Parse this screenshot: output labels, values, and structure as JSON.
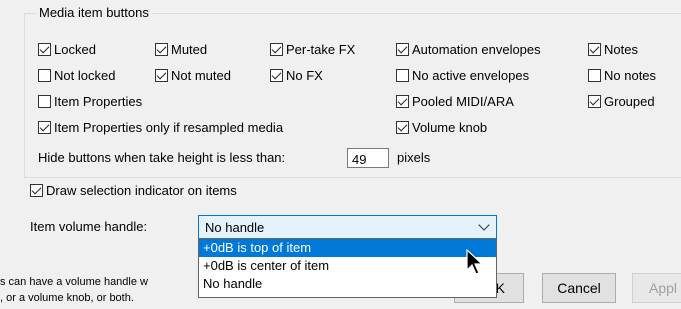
{
  "group": {
    "title": "Media item buttons",
    "checkboxes": [
      {
        "label": "Locked",
        "checked": true
      },
      {
        "label": "Muted",
        "checked": true
      },
      {
        "label": "Per-take FX",
        "checked": true
      },
      {
        "label": "Automation envelopes",
        "checked": true
      },
      {
        "label": "Notes",
        "checked": true
      },
      {
        "label": "Not locked",
        "checked": false
      },
      {
        "label": "Not muted",
        "checked": true
      },
      {
        "label": "No FX",
        "checked": true
      },
      {
        "label": "No active envelopes",
        "checked": false
      },
      {
        "label": "No notes",
        "checked": false
      },
      {
        "label": "Item Properties",
        "checked": false
      },
      {
        "label": "Pooled MIDI/ARA",
        "checked": true
      },
      {
        "label": "Grouped",
        "checked": true
      },
      {
        "label": "Item Properties only if resampled media",
        "checked": true
      },
      {
        "label": "Volume knob",
        "checked": true
      }
    ],
    "hide_label": "Hide buttons when take height is less than:",
    "hide_value": "49",
    "hide_unit": "pixels"
  },
  "draw_selection": {
    "label": "Draw selection indicator on items",
    "checked": true
  },
  "volume_handle": {
    "label": "Item volume handle:",
    "selected": "No handle",
    "options": [
      "+0dB is top of item",
      "+0dB is center of item",
      "No handle"
    ],
    "highlighted_index": 0
  },
  "help_text": {
    "line1": "s can have a volume handle w",
    "line2": ", or a volume knob, or both."
  },
  "buttons": {
    "ok_fragment": "K",
    "cancel": "Cancel",
    "apply_fragment": "Appl"
  }
}
